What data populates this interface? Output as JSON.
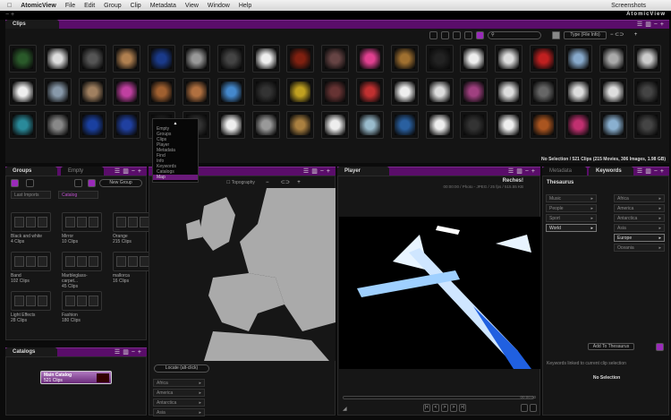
{
  "menubar": {
    "app": "AtomicView",
    "items": [
      "File",
      "Edit",
      "Group",
      "Clip",
      "Metadata",
      "View",
      "Window",
      "Help"
    ],
    "right": "Screenshots"
  },
  "window": {
    "logo": "AtomicView",
    "min_max": "− +"
  },
  "clips": {
    "tab": "Clips",
    "toolbar": {
      "type_select": "Type (File Info)"
    },
    "status": "No Selection  /  521 Clips (215 Movies, 306 Images, 1.98 GB)",
    "thumbs": [
      "#2a5a2a",
      "#ddd",
      "#555",
      "#b08050",
      "#1a3a8a",
      "#999",
      "#444",
      "#eee",
      "#802010",
      "#664444",
      "#e04090",
      "#a07030",
      "#222",
      "#eee",
      "#ddd",
      "#c02020",
      "#88aacc",
      "#aaa",
      "#ccc",
      "#eee",
      "#8899aa",
      "#a08060",
      "#c040a0",
      "#a06030",
      "#b07040",
      "#4488cc",
      "#333",
      "#c0a020",
      "#663333",
      "#c03030",
      "#eee",
      "#ddd",
      "#a04080",
      "#ddd",
      "#666",
      "#ddd",
      "#ddd",
      "#444",
      "#2a8a9a",
      "#888",
      "#1a40a0",
      "#2040a0",
      "#222",
      "#333",
      "#eee",
      "#999",
      "#aa8040",
      "#eee",
      "#99bbcc",
      "#2a60a0",
      "#eee",
      "#333",
      "#eee",
      "#aa5520",
      "#c03070",
      "#8ab0d0",
      "#444"
    ]
  },
  "dropdown": {
    "items": [
      "Empty",
      "Groups",
      "Clips",
      "Player",
      "Metadata",
      "Find",
      "Info",
      "Keywords",
      "Catalogs",
      "Map"
    ],
    "active": "Map"
  },
  "groups": {
    "tab": "Groups",
    "tab2": "Empty",
    "new_group": "New Group",
    "last_imports": "Last Imports",
    "catalog": "Catalog",
    "items": [
      {
        "name": "Black and white",
        "count": "4 Clips"
      },
      {
        "name": "Mirror",
        "count": "10 Clips"
      },
      {
        "name": "Orange",
        "count": "215 Clips"
      },
      {
        "name": "Band",
        "count": "102 Clips"
      },
      {
        "name": "Marbleglass-carpet...",
        "count": "45 Clips"
      },
      {
        "name": "mallorca",
        "count": "16 Clips"
      },
      {
        "name": "Light Effects",
        "count": "28 Clips"
      },
      {
        "name": "Fashion",
        "count": "180 Clips"
      }
    ]
  },
  "catalogs": {
    "tab": "Catalogs",
    "main": "Main Catalog",
    "count": "521 Clips"
  },
  "map": {
    "topography": "Topography",
    "locate": "Locate (alt-click)",
    "regions": [
      "Africa",
      "America",
      "Antarctica",
      "Asia"
    ]
  },
  "player": {
    "tab": "Player",
    "title": "Reches!",
    "info": "00:00:00  /  Photo - JPEG / 25 fps / 515.55 KB",
    "time": "00:00:00"
  },
  "keywords": {
    "tab_meta": "Metadata",
    "tab": "Keywords",
    "thesaurus": "Thesaurus",
    "left": [
      "Music",
      "People",
      "Sport",
      "World"
    ],
    "left_sel": "World",
    "right": [
      "Africa",
      "America",
      "Antarctica",
      "Asia",
      "Europe",
      "Oceania"
    ],
    "right_sel": "Europe",
    "add": "Add To Thesaurus",
    "linked": "Keywords linked to current clip selection",
    "none": "No Selection"
  }
}
